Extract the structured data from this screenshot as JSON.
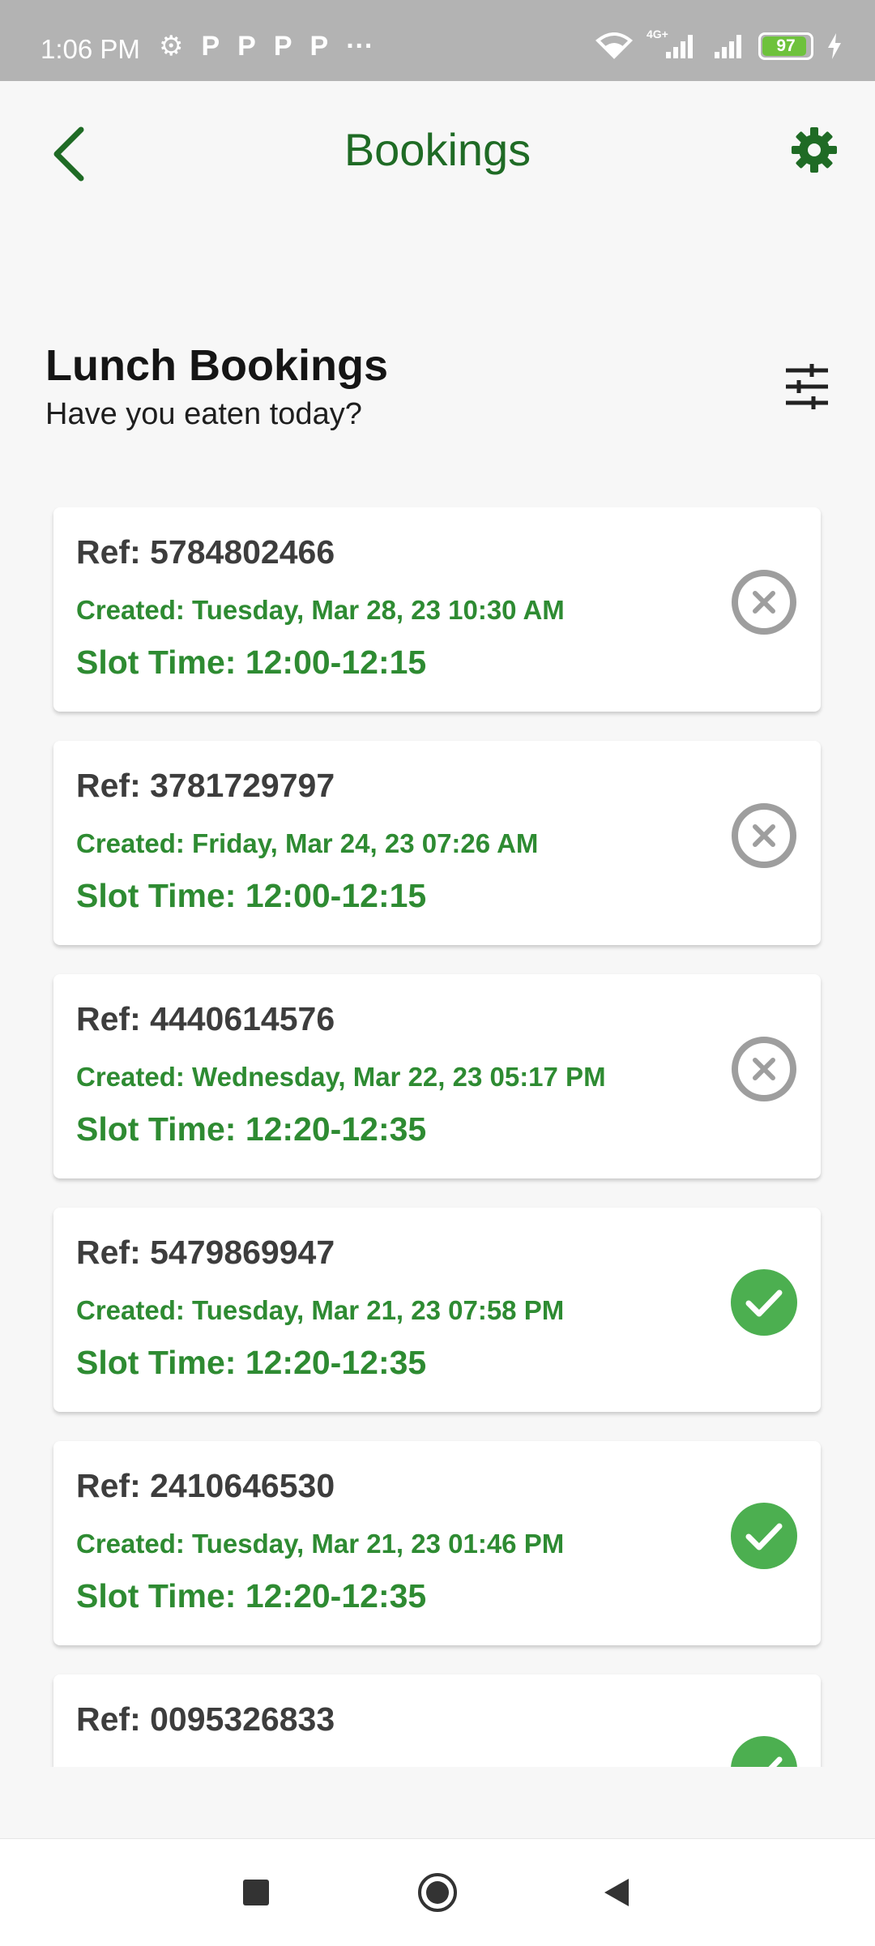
{
  "status_bar": {
    "time": "1:06 PM",
    "left_icons": [
      "gear-icon",
      "P",
      "P",
      "P",
      "P",
      "···"
    ],
    "network": "4G+",
    "battery": "97"
  },
  "app_bar": {
    "title": "Bookings",
    "back_icon": "chevron-left-icon",
    "settings_icon": "gear-icon"
  },
  "section": {
    "title": "Lunch Bookings",
    "subtitle": "Have you eaten today?",
    "filter_icon": "sliders-icon"
  },
  "bookings": [
    {
      "ref": "Ref: 5784802466",
      "created": "Created: Tuesday, Mar 28, 23 10:30 AM",
      "slot": "Slot Time: 12:00-12:15",
      "status": "cancelled"
    },
    {
      "ref": "Ref: 3781729797",
      "created": "Created: Friday, Mar 24, 23 07:26 AM",
      "slot": "Slot Time: 12:00-12:15",
      "status": "cancelled"
    },
    {
      "ref": "Ref: 4440614576",
      "created": "Created: Wednesday, Mar 22, 23 05:17 PM",
      "slot": "Slot Time: 12:20-12:35",
      "status": "cancelled"
    },
    {
      "ref": "Ref: 5479869947",
      "created": "Created: Tuesday, Mar 21, 23 07:58 PM",
      "slot": "Slot Time: 12:20-12:35",
      "status": "completed"
    },
    {
      "ref": "Ref: 2410646530",
      "created": "Created: Tuesday, Mar 21, 23 01:46 PM",
      "slot": "Slot Time: 12:20-12:35",
      "status": "completed"
    },
    {
      "ref": "Ref: 0095326833",
      "created": "",
      "slot": "",
      "status": "completed"
    }
  ],
  "colors": {
    "primary": "#1f6b25",
    "accent_text": "#2e8b32",
    "success": "#4caf50",
    "cancel_grey": "#9e9e9e",
    "status_bar": "#b3b3b3",
    "background": "#f7f7f7"
  },
  "nav_bar": {
    "icons": [
      "square-recents-icon",
      "circle-home-icon",
      "triangle-back-icon"
    ]
  }
}
